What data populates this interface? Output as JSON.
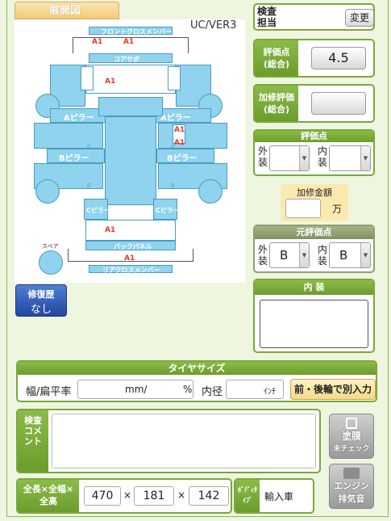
{
  "diagram": {
    "tab_label": "展開図",
    "version": "UC/VER3",
    "parts": {
      "front_cross_member": "フロントクロスメンバー",
      "core_support": "コアサポ",
      "a_pillar_left": "Aピラー",
      "a_pillar_right": "Aピラー",
      "b_pillar_left": "Bピラー",
      "b_pillar_right": "Bピラー",
      "c_pillar_left": "Cピラー",
      "c_pillar_right": "Cピラー",
      "back_panel": "バックパネル",
      "rear_cross_member": "リアクロスメンバー",
      "spare": "スペア"
    },
    "damage_marks": [
      "A1",
      "A1",
      "A1",
      "A1",
      "A1",
      "A1",
      "A1"
    ],
    "zero": "0"
  },
  "repair_history": {
    "label": "修復歴",
    "value": "なし"
  },
  "inspector": {
    "label": "検査担当",
    "change_button": "変更"
  },
  "score": {
    "label": "評価点(総合)",
    "value": "4.5"
  },
  "repair_score": {
    "label": "加修評価(総合)",
    "value": ""
  },
  "rating": {
    "header": "評価点",
    "exterior_label": "外装",
    "interior_label": "内装",
    "exterior_value": "",
    "interior_value": ""
  },
  "repair_amount": {
    "label": "加修金額",
    "unit": "万",
    "value": ""
  },
  "original_rating": {
    "header": "元評価点",
    "exterior_label": "外装",
    "interior_label": "内装",
    "exterior_value": "B",
    "interior_value": "B"
  },
  "interior": {
    "header": "内 装",
    "value": ""
  },
  "tire": {
    "header": "タイヤサイズ",
    "width_label": "幅/扁平率",
    "mm_unit": "mm/",
    "pct_unit": "%",
    "inner_label": "内径",
    "inch_unit": "ｲﾝﾁ",
    "split_button": "前・後輪で別入力"
  },
  "comment": {
    "label": "検査コメント",
    "value": ""
  },
  "paint_button": {
    "line1": "塗膜",
    "line2": "未チェック"
  },
  "engine_button": {
    "line1": "エンジン",
    "line2": "排気音"
  },
  "dimensions": {
    "label": "全長×全幅×全高",
    "length": "470",
    "width": "181",
    "height": "142",
    "times": "×"
  },
  "body_type": {
    "label": "ﾎﾞﾃﾞｨﾀｲﾌﾟ",
    "value": "輸入車"
  }
}
